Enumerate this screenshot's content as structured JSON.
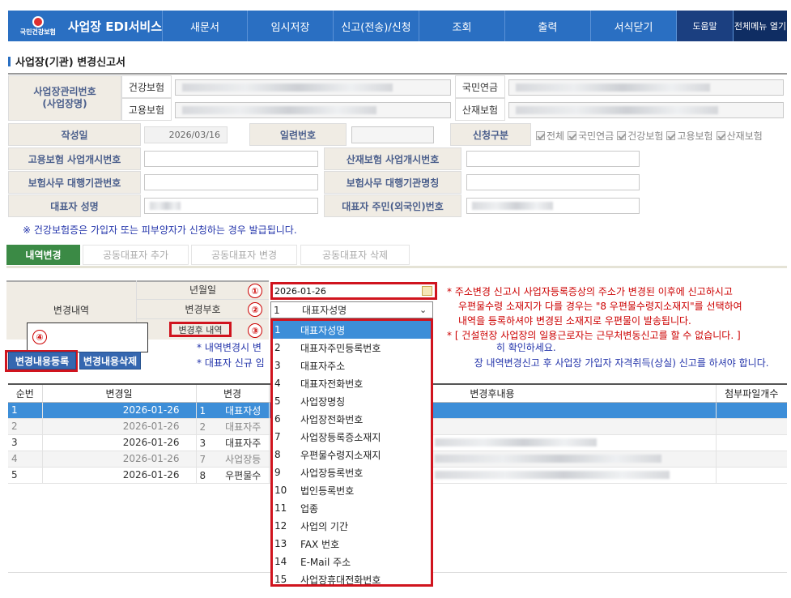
{
  "header": {
    "logo_text": "국민건강보험",
    "app_title": "사업장 EDI서비스",
    "nav": [
      {
        "label": "새문서"
      },
      {
        "label": "임시저장"
      },
      {
        "label": "신고(전송)/신청"
      },
      {
        "label": "조회"
      },
      {
        "label": "출력"
      },
      {
        "label": "서식닫기"
      },
      {
        "label": "도움말"
      },
      {
        "label": "전체메뉴 열기"
      }
    ]
  },
  "page_title": "사업장(기관) 변경신고서",
  "form": {
    "biz_no_label": "사업장관리번호\n(사업장명)",
    "health_label": "건강보험",
    "employ_label": "고용보험",
    "pension_label": "국민연금",
    "accident_label": "산재보험",
    "write_date_label": "작성일",
    "write_date": "2026/03/16",
    "serial_label": "일련번호",
    "apply_type_label": "신청구분",
    "apply_types": [
      "전체",
      "국민연금",
      "건강보험",
      "고용보험",
      "산재보험"
    ],
    "employ_start_label": "고용보험 사업개시번호",
    "accident_start_label": "산재보험 사업개시번호",
    "agency_no_label": "보험사무 대행기관번호",
    "agency_name_label": "보험사무 대행기관명칭",
    "rep_name_label": "대표자 성명",
    "rep_id_label": "대표자 주민(외국인)번호",
    "notice": "※ 건강보험증은 가입자 또는 피부양자가 신청하는 경우 발급됩니다."
  },
  "tabs": [
    "내역변경",
    "공동대표자 추가",
    "공동대표자 변경",
    "공동대표자 삭제"
  ],
  "change": {
    "section_label": "변경내역",
    "ym_label": "년월일",
    "ym_value": "2026-01-26",
    "code_label": "변경부호",
    "code_selected_no": "1",
    "code_selected": "대표자성명",
    "after_label": "변경후 내역",
    "markers": [
      "①",
      "②",
      "③",
      "④"
    ],
    "note_r1": "* 주소변경 신고시 사업자등록증상의 주소가 변경된 이후에 신고하시고",
    "note_r2": "우편물수령 소재지가 다를 경우는 \"8 우편물수령지소재지\"를 선택하여",
    "note_r3": "내역을 등록하셔야 변경된 소재지로 우편물이 발송됩니다.",
    "note_r4": "* [ 건설현장 사업장의 일용근로자는 근무처변동신고를 할 수 없습니다. ]",
    "note_b1a": "* 내역변경시 변",
    "note_b1b": "히 확인하세요.",
    "note_b2a": "* 대표자 신규 임",
    "note_b2b": "장 내역변경신고 후 사업장 가입자 자격취득(상실) 신고를 하셔야 합니다.",
    "btn_register": "변경내용등록",
    "btn_delete": "변경내용삭제"
  },
  "table": {
    "headers": [
      "순번",
      "변경일",
      "변경",
      "변경후내용",
      "첨부파일개수"
    ],
    "rows": [
      {
        "no": "1",
        "date": "2026-01-26",
        "code": "1",
        "name": "대표자성"
      },
      {
        "no": "2",
        "date": "2026-01-26",
        "code": "2",
        "name": "대표자주"
      },
      {
        "no": "3",
        "date": "2026-01-26",
        "code": "3",
        "name": "대표자주"
      },
      {
        "no": "4",
        "date": "2026-01-26",
        "code": "7",
        "name": "사업장등"
      },
      {
        "no": "5",
        "date": "2026-01-26",
        "code": "8",
        "name": "우편물수"
      }
    ]
  },
  "dropdown": {
    "options": [
      {
        "no": "1",
        "label": "대표자성명"
      },
      {
        "no": "2",
        "label": "대표자주민등록번호"
      },
      {
        "no": "3",
        "label": "대표자주소"
      },
      {
        "no": "4",
        "label": "대표자전화번호"
      },
      {
        "no": "5",
        "label": "사업장명칭"
      },
      {
        "no": "6",
        "label": "사업장전화번호"
      },
      {
        "no": "7",
        "label": "사업장등록증소재지"
      },
      {
        "no": "8",
        "label": "우편물수령지소재지"
      },
      {
        "no": "9",
        "label": "사업장등록번호"
      },
      {
        "no": "10",
        "label": "법인등록번호"
      },
      {
        "no": "11",
        "label": "업종"
      },
      {
        "no": "12",
        "label": "사업의 기간"
      },
      {
        "no": "13",
        "label": "FAX 번호"
      },
      {
        "no": "14",
        "label": "E-Mail 주소"
      },
      {
        "no": "15",
        "label": "사업장휴대전화번호"
      }
    ]
  },
  "colors": {
    "brand": "#2a6fc2",
    "accent_red": "#d0141e",
    "tab_green": "#3b8a45",
    "select_blue": "#3d8ed8"
  }
}
